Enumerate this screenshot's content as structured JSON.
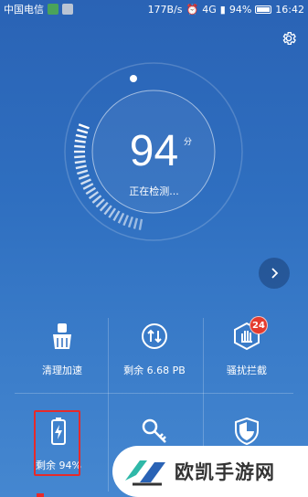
{
  "status_bar": {
    "carrier": "中国电信",
    "speed": "177B/s",
    "network": "4G",
    "battery": "94%",
    "time": "16:42"
  },
  "score": {
    "value": "94",
    "unit": "分",
    "status": "正在检测..."
  },
  "gauge": {
    "progress": 0.94
  },
  "tiles": [
    {
      "label": "清理加速",
      "icon": "broom-icon"
    },
    {
      "label": "剩余 6.68 PB",
      "icon": "transfer-icon"
    },
    {
      "label": "骚扰拦截",
      "icon": "hand-block-icon",
      "badge": "24"
    },
    {
      "label": "剩余 94%",
      "icon": "battery-icon"
    },
    {
      "label": "",
      "icon": "key-icon"
    },
    {
      "label": "",
      "icon": "shield-icon"
    }
  ],
  "watermark": {
    "text": "欧凯手游网"
  },
  "colors": {
    "accent": "#2f6fc0",
    "badge": "#e43b2e",
    "highlight": "#e62a2a"
  }
}
